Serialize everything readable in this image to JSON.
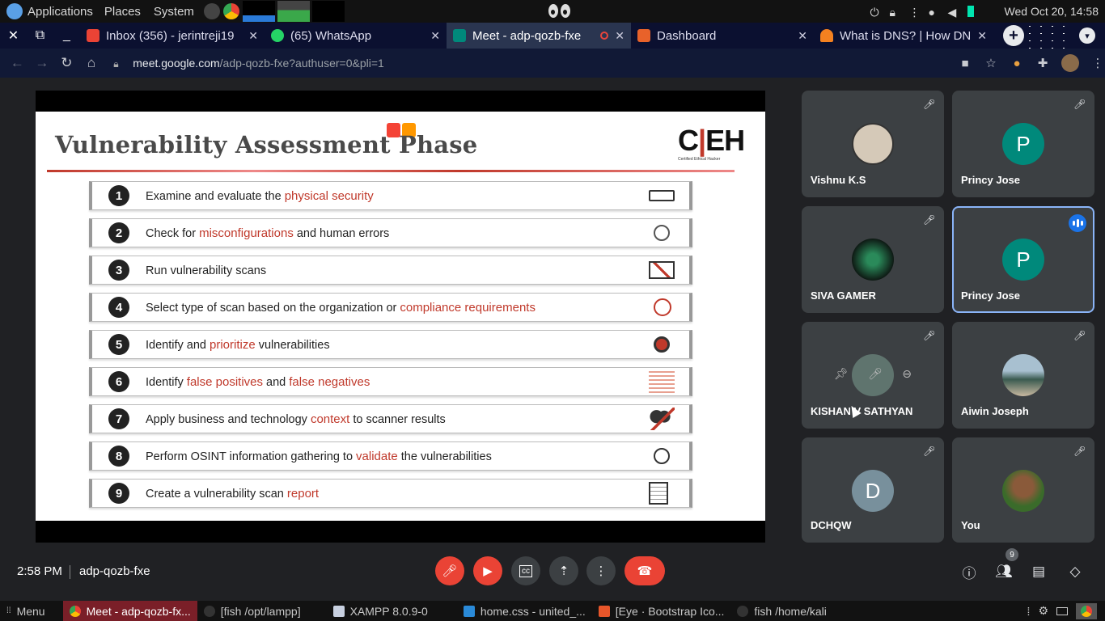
{
  "system_panel": {
    "applications": "Applications",
    "places": "Places",
    "system": "System",
    "datetime": "Wed Oct 20, 14:58"
  },
  "tabs": [
    {
      "title": "Inbox (356) - jerintreji19",
      "icon": "gmail-icon",
      "color": "#ea4335"
    },
    {
      "title": "(65) WhatsApp",
      "icon": "whatsapp-icon",
      "color": "#25d366"
    },
    {
      "title": "Meet - adp-qozb-fxe",
      "icon": "meet-icon",
      "color": "#00897b",
      "active": true
    },
    {
      "title": "Dashboard",
      "icon": "dashboard-icon",
      "color": "#e8622a"
    },
    {
      "title": "What is DNS? | How DN",
      "icon": "cloudflare-icon",
      "color": "#f48120"
    }
  ],
  "address": {
    "domain": "meet.google.com",
    "path": "/adp-qozb-fxe?authuser=0&pli=1"
  },
  "slide": {
    "title": "Vulnerability Assessment Phase",
    "logo_letters": [
      "C",
      "|",
      "EH"
    ],
    "logo_sub": "Certified Ethical Hacker",
    "steps": [
      {
        "num": "1",
        "before": "Examine and evaluate the ",
        "highlight": "physical security",
        "after": ""
      },
      {
        "num": "2",
        "before": "Check for ",
        "highlight": "misconfigurations",
        "after": " and human errors"
      },
      {
        "num": "3",
        "before": "Run vulnerability scans",
        "highlight": "",
        "after": ""
      },
      {
        "num": "4",
        "before": "Select type of scan based on the organization or ",
        "highlight": "compliance requirements",
        "after": ""
      },
      {
        "num": "5",
        "before": "Identify and ",
        "highlight": "prioritize",
        "after": " vulnerabilities"
      },
      {
        "num": "6",
        "before": "Identify ",
        "highlight": "false positives",
        "after": " and ",
        "highlight2": "false negatives"
      },
      {
        "num": "7",
        "before": "Apply business and technology ",
        "highlight": "context",
        "after": " to scanner results"
      },
      {
        "num": "8",
        "before": "Perform OSINT information gathering to ",
        "highlight": "validate",
        "after": " the vulnerabilities"
      },
      {
        "num": "9",
        "before": "Create a vulnerability scan ",
        "highlight": "report",
        "after": ""
      }
    ]
  },
  "participants": [
    {
      "name": "Vishnu K.S",
      "avatar": "photo",
      "color": "#9aa0a6"
    },
    {
      "name": "Princy Jose",
      "avatar": "P",
      "color": "#00897b"
    },
    {
      "name": "SIVA GAMER",
      "avatar": "photo",
      "color": "#1e3a2e"
    },
    {
      "name": "Princy Jose",
      "avatar": "P",
      "color": "#00897b",
      "speaking": true
    },
    {
      "name": "KISHAN V SATHYAN",
      "avatar": "photo",
      "color": "#6d8a80"
    },
    {
      "name": "Aiwin Joseph",
      "avatar": "photo",
      "color": "#4a7080"
    },
    {
      "name": "DCHQW",
      "avatar": "D",
      "color": "#78909c"
    },
    {
      "name": "You",
      "avatar": "photo",
      "color": "#3a6b2a"
    }
  ],
  "meet_bar": {
    "time": "2:58 PM",
    "code": "adp-qozb-fxe",
    "people_count": "9"
  },
  "taskbar": {
    "menu": "Menu",
    "items": [
      {
        "label": "Meet - adp-qozb-fx...",
        "icon": "chrome-icon",
        "active": true
      },
      {
        "label": "[fish /opt/lampp]",
        "icon": "terminal-icon"
      },
      {
        "label": "XAMPP 8.0.9-0",
        "icon": "window-icon"
      },
      {
        "label": "home.css - united_...",
        "icon": "vscode-icon"
      },
      {
        "label": "[Eye · Bootstrap Ico...",
        "icon": "brave-icon"
      },
      {
        "label": "fish /home/kali",
        "icon": "terminal-icon"
      }
    ]
  }
}
